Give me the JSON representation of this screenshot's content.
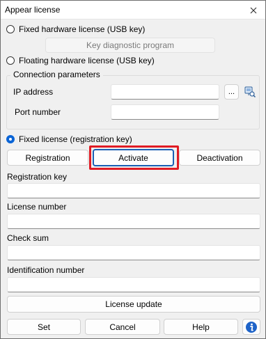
{
  "window": {
    "title": "Appear license"
  },
  "usb": {
    "fixed_label": "Fixed hardware license (USB key)",
    "diagnostic_label": "Key diagnostic program",
    "floating_label": "Floating hardware license (USB key)"
  },
  "connection": {
    "title": "Connection parameters",
    "ip_label": "IP address",
    "ip_value": "",
    "port_label": "Port number",
    "port_value": "",
    "browse_label": "..."
  },
  "fixed_reg": {
    "label": "Fixed license (registration key)",
    "selected": true
  },
  "actions": {
    "registration": "Registration",
    "activate": "Activate",
    "deactivation": "Deactivation"
  },
  "fields": {
    "registration_key_label": "Registration key",
    "registration_key_value": "",
    "license_number_label": "License number",
    "license_number_value": "",
    "check_sum_label": "Check sum",
    "check_sum_value": "",
    "identification_number_label": "Identification number",
    "identification_number_value": ""
  },
  "license_update": "License update",
  "footer": {
    "set": "Set",
    "cancel": "Cancel",
    "help": "Help"
  },
  "icons": {
    "close": "close-icon",
    "network": "network-search-icon",
    "info": "info-icon"
  }
}
